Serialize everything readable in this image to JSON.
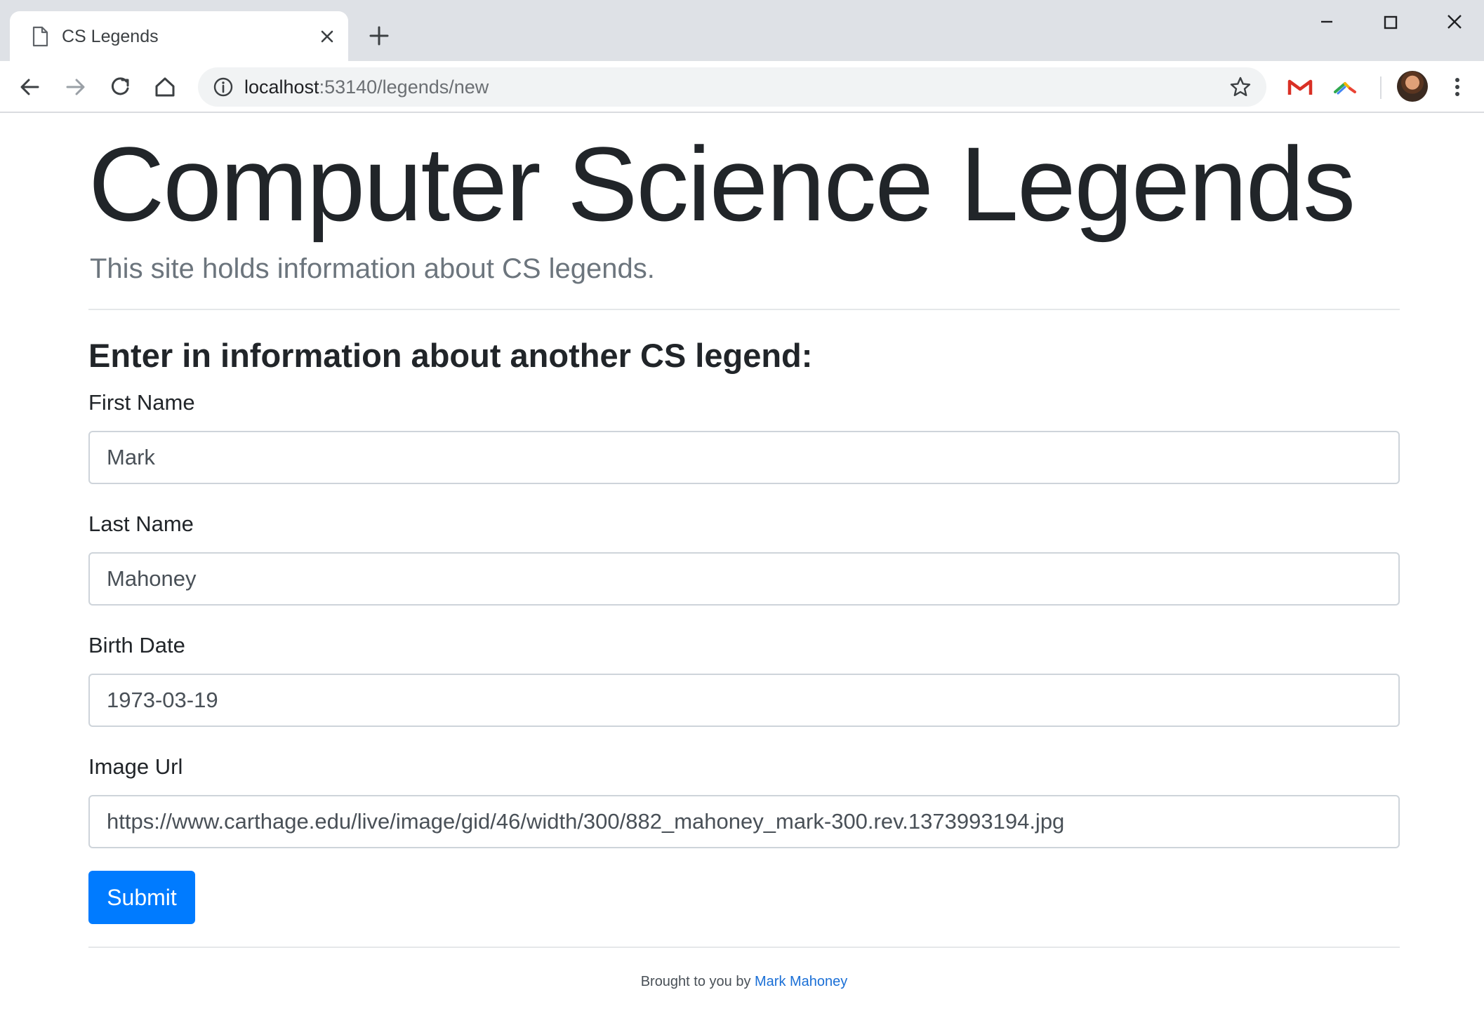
{
  "browser": {
    "tab": {
      "title": "CS Legends",
      "favicon": "page-icon",
      "close_icon": "close-icon"
    },
    "new_tab_icon": "plus-icon",
    "window_controls": [
      "minimize-icon",
      "maximize-icon",
      "close-icon"
    ],
    "toolbar": {
      "nav_icons": [
        "back-arrow-icon",
        "forward-arrow-icon",
        "reload-icon",
        "home-icon"
      ],
      "address_bar": {
        "info_icon": "info-icon",
        "host": "localhost",
        "path": ":53140/legends/new",
        "star_icon": "star-icon"
      },
      "extensions": [
        "gmail-icon",
        "rainbow-extension-icon"
      ],
      "avatar": "profile-avatar",
      "menu_icon": "kebab-menu-icon"
    }
  },
  "page": {
    "title": "Computer Science Legends",
    "lead": "This site holds information about CS legends.",
    "form": {
      "heading": "Enter in information about another CS legend:",
      "fields": [
        {
          "label": "First Name",
          "value": "Mark"
        },
        {
          "label": "Last Name",
          "value": "Mahoney"
        },
        {
          "label": "Birth Date",
          "value": "1973-03-19"
        },
        {
          "label": "Image Url",
          "value": "https://www.carthage.edu/live/image/gid/46/width/300/882_mahoney_mark-300.rev.1373993194.jpg"
        }
      ],
      "submit_label": "Submit"
    },
    "footer": {
      "prefix": "Brought to you by ",
      "link_text": "Mark Mahoney"
    }
  },
  "colors": {
    "primary": "#007bff",
    "link": "#1a6fd6",
    "tabstrip": "#dee1e6",
    "omnibox": "#f1f3f4",
    "gmail_red": "#d93025"
  }
}
